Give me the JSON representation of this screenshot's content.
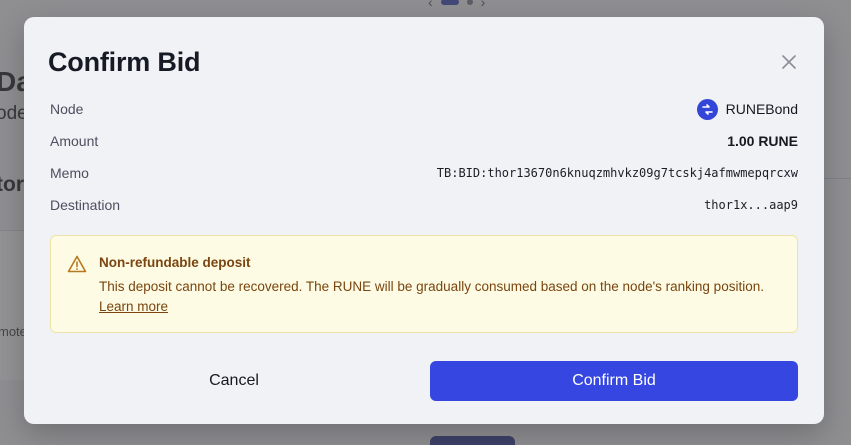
{
  "background": {
    "heading": "Da",
    "subheading": "ode",
    "section_heading": "tor",
    "snippet": "mote"
  },
  "modal": {
    "title": "Confirm Bid",
    "close_icon": "close-icon",
    "rows": [
      {
        "label": "Node",
        "value": "RUNEBond",
        "icon": "runebond-logo-icon"
      },
      {
        "label": "Amount",
        "value": "1.00 RUNE"
      },
      {
        "label": "Memo",
        "value": "TB:BID:thor13670n6knuqzmhvkz09g7tcskj4afmwmepqrcxw"
      },
      {
        "label": "Destination",
        "value": "thor1x...aap9"
      }
    ],
    "warning": {
      "icon": "warning-triangle-icon",
      "title": "Non-refundable deposit",
      "body": "This deposit cannot be recovered. The RUNE will be gradually consumed based on the node's ranking position.",
      "link": "Learn more"
    },
    "buttons": {
      "cancel": "Cancel",
      "confirm": "Confirm Bid"
    }
  },
  "colors": {
    "primary": "#3547e0",
    "warning_bg": "#fdfbe3",
    "warning_border": "#ede3a6",
    "warning_text": "#7a4510",
    "modal_bg": "#f1f2f5"
  }
}
